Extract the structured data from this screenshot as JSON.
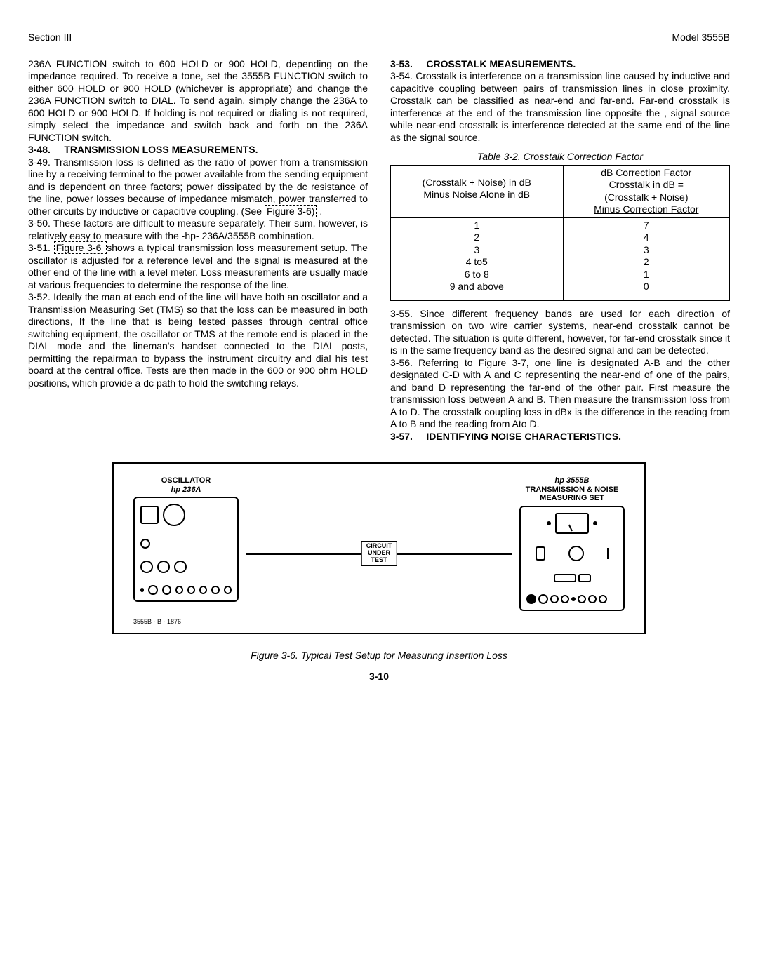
{
  "header": {
    "left": "Section III",
    "right": "Model 3555B"
  },
  "col1": {
    "p47b": "236A FUNCTION switch to 600 HOLD or 900 HOLD, depending on the impedance required.  To receive a tone, set the 3555B FUNCTION switch to either 600 HOLD or 900 HOLD (whichever is appropriate) and change the 236A FUNCTION switch to DIAL.  To send again, simply change the 236A to 600 HOLD or 900 HOLD.  If holding is not required or dialing is not required, simply select the impedance and switch back and forth on the 236A FUNCTION switch.",
    "h348_num": "3-48.",
    "h348_title": "TRANSMISSION LOSS MEASUREMENTS.",
    "p349a": "3-49.    Transmission loss is defined as the ratio of power from a transmission line by a receiving terminal to the power available from the sending equipment and is dependent on three factors; power dissipated by the dc resistance of the line, power losses because of impedance mismatch, power transferred to other circuits by inductive or capacitive coupling.  (See",
    "p349_link": " Figure 3-6)",
    "p349b": ".",
    "p350": "3-50.    These factors are difficult to measure separately.  Their sum, however, is relatively easy to measure with the -hp- 236A/3555B combination.",
    "p351a": "3-51.   ",
    "p351_link": " Figure 3-6 ",
    "p351b": " shows a typical transmission loss measurement setup.  The oscillator is adjusted for a reference level and the signal is measured at the other end of the line with a level meter.  Loss measurements are usually made at various frequencies to determine the response of the line.",
    "p352": "3-52.    Ideally the man at each end of the line will have both an oscillator and a Transmission Measuring Set (TMS) so that the loss can be measured in both directions, If the line that is being tested passes through central office switching equipment, the oscillator or TMS at the remote end is placed in the DIAL mode and the lineman's handset connected to the DIAL posts, permitting the repairman to bypass the instrument circuitry and dial his test board at the central office.  Tests are then made in the 600 or 900 ohm HOLD positions, which provide a dc path to hold the switching relays."
  },
  "col2": {
    "h353_num": "3-53.",
    "h353_title": "CROSSTALK MEASUREMENTS.",
    "p354": "3-54.    Crosstalk is interference on a transmission line caused by inductive and capacitive coupling between pairs of transmission lines in close proximity.  Crosstalk can be classified as near-end and far-end.  Far-end crosstalk is interference at the end of the transmission line opposite the , signal source while near-end crosstalk is interference detected at the same end of the line as the signal source.",
    "table_caption": "Table 3-2.  Crosstalk Correction Factor",
    "th1a": "(Crosstalk + Noise) in dB",
    "th1b": "Minus Noise Alone in dB",
    "th2a": "dB Correction Factor",
    "th2b": "Crosstalk in dB =",
    "th2c": "(Crosstalk + Noise)",
    "th2d": "Minus Correction Factor",
    "rows": [
      {
        "a": "1",
        "b": "7"
      },
      {
        "a": "2",
        "b": "4"
      },
      {
        "a": "3",
        "b": "3"
      },
      {
        "a": "4 to5",
        "b": "2"
      },
      {
        "a": "6 to 8",
        "b": "1"
      },
      {
        "a": "9 and above",
        "b": "0"
      }
    ],
    "p355": "3-55.    Since different frequency bands are used for each direction of transmission on two wire carrier systems, near-end crosstalk cannot be detected.  The situation is quite different, however, for far-end crosstalk since it is in the same frequency band as the desired signal and can be detected.",
    "p356": "3-56.    Referring to Figure 3-7, one line is designated A-B and the other designated C-D with A and C representing the near-end of one of the pairs, and band D representing the far-end of the other pair.  First measure the transmission loss between A and B.  Then measure the transmission loss from A to D.  The crosstalk coupling loss in dBx is the difference in the reading from A to B and the reading from Ato D.",
    "h357_num": "3-57.",
    "h357_title": "IDENTIFYING NOISE CHARACTERISTICS."
  },
  "figure": {
    "left_label_1": "OSCILLATOR",
    "left_label_2": "hp 236A",
    "right_label_0": "hp 3555B",
    "right_label_1": "TRANSMISSION & NOISE",
    "right_label_2": "MEASURING SET",
    "cut_l1": "CIRCUIT",
    "cut_l2": "UNDER",
    "cut_l3": "TEST",
    "partno": "3555B - B - 1876",
    "caption": "Figure 3-6.  Typical Test Setup for Measuring Insertion Loss"
  },
  "page": "3-10"
}
